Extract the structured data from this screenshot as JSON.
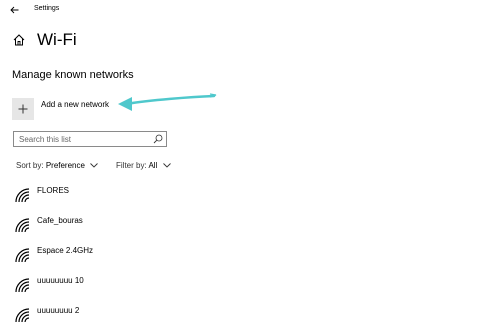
{
  "window": {
    "app_title": "Settings",
    "back_icon": "back-arrow-icon"
  },
  "header": {
    "home_icon": "home-icon",
    "title": "Wi-Fi"
  },
  "section": {
    "title": "Manage known networks"
  },
  "add_network": {
    "icon": "plus-icon",
    "label": "Add a new network"
  },
  "annotation": {
    "color": "#4fc8cc"
  },
  "search": {
    "placeholder": "Search this list",
    "value": "",
    "icon": "search-icon"
  },
  "filters": {
    "sort_label": "Sort by:",
    "sort_value": "Preference",
    "filter_label": "Filter by:",
    "filter_value": "All"
  },
  "networks": [
    {
      "name": "FLORES",
      "icon": "wifi-icon"
    },
    {
      "name": "Cafe_bouras",
      "icon": "wifi-icon"
    },
    {
      "name": "Espace 2.4GHz",
      "icon": "wifi-icon"
    },
    {
      "name": "uuuuuuuu 10",
      "icon": "wifi-icon"
    },
    {
      "name": "uuuuuuuu 2",
      "icon": "wifi-icon"
    }
  ]
}
